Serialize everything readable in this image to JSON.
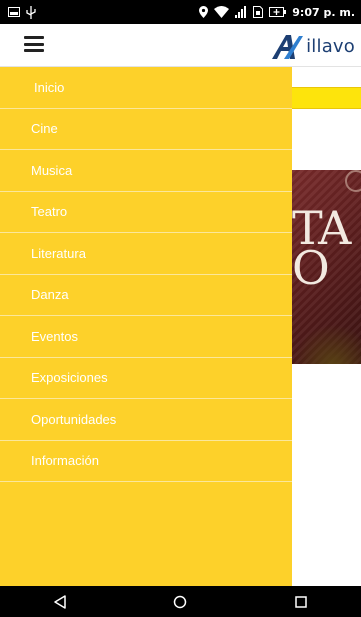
{
  "status_bar": {
    "time": "9:07 p. m.",
    "icons": [
      "screenshot-icon",
      "usb-icon",
      "location-icon",
      "wifi-icon",
      "signal-icon",
      "sim-icon",
      "battery-icon"
    ]
  },
  "header": {
    "menu_icon": "hamburger-menu-icon",
    "brand_text": "illavo",
    "brand_color": "#1d3f73"
  },
  "background": {
    "banner_text": "TA\nO",
    "accent_yellow": "#fde40c"
  },
  "drawer": {
    "bg_color": "#fdd12a",
    "items": [
      {
        "label": "Inicio"
      },
      {
        "label": "Cine"
      },
      {
        "label": "Musica"
      },
      {
        "label": "Teatro"
      },
      {
        "label": "Literatura"
      },
      {
        "label": "Danza"
      },
      {
        "label": "Eventos"
      },
      {
        "label": "Exposiciones"
      },
      {
        "label": "Oportunidades"
      },
      {
        "label": "Información"
      }
    ]
  },
  "navbar": {
    "buttons": [
      "back-triangle-icon",
      "home-circle-icon",
      "recents-square-icon"
    ]
  }
}
